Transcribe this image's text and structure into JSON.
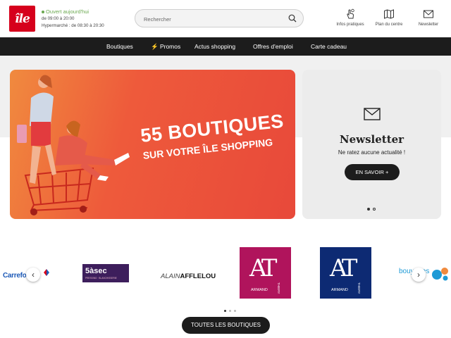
{
  "header": {
    "logo_text": "île",
    "open_status": "Ouvert aujourd'hui",
    "hours_line1": "de 09:00 à 20:00",
    "hours_line2": "Hypermarché : de 08:30 à 20:30",
    "search": {
      "placeholder": "Rechercher",
      "value": ""
    },
    "items": [
      {
        "label": "Infos pratiques",
        "icon": "hand-pointer-icon"
      },
      {
        "label": "Plan du centre",
        "icon": "map-icon"
      },
      {
        "label": "Newsletter",
        "icon": "envelope-icon"
      }
    ]
  },
  "nav": [
    "Boutiques",
    "⚡ Promos",
    "Actus shopping",
    "Offres d'emploi",
    "Carte cadeau"
  ],
  "hero": {
    "headline1": "55 BOUTIQUES",
    "headline2": "SUR VOTRE ÎLE SHOPPING"
  },
  "newsletter_card": {
    "title": "Newsletter",
    "subtitle": "Ne ratez aucune actualité !",
    "button": "EN SAVOIR +"
  },
  "brands": {
    "items": [
      {
        "name": "Carrefour",
        "color": "#1e5bb8"
      },
      {
        "name": "5àsec",
        "sub": "PRESSING · BLANCHISSERIE",
        "color": "#3d1e5c"
      },
      {
        "name": "ALAINAFFLELOU",
        "part1": "ALAIN",
        "part2": "AFFLELOU",
        "color": "#222222"
      },
      {
        "name": "AT",
        "sub": "ARMAND",
        "sub2": "THIERY",
        "color": "#b0145c"
      },
      {
        "name": "AT",
        "sub": "ARMAND",
        "sub2": "THIERY",
        "color": "#0d2a73"
      },
      {
        "name": "bouygues",
        "color": "#1d9ad6"
      }
    ],
    "button": "TOUTES LES BOUTIQUES"
  },
  "colors": {
    "brand_red": "#d6001c",
    "dark": "#1c1c1c",
    "hero_orange": "#ee5a3b",
    "open_green": "#6aa84f"
  }
}
